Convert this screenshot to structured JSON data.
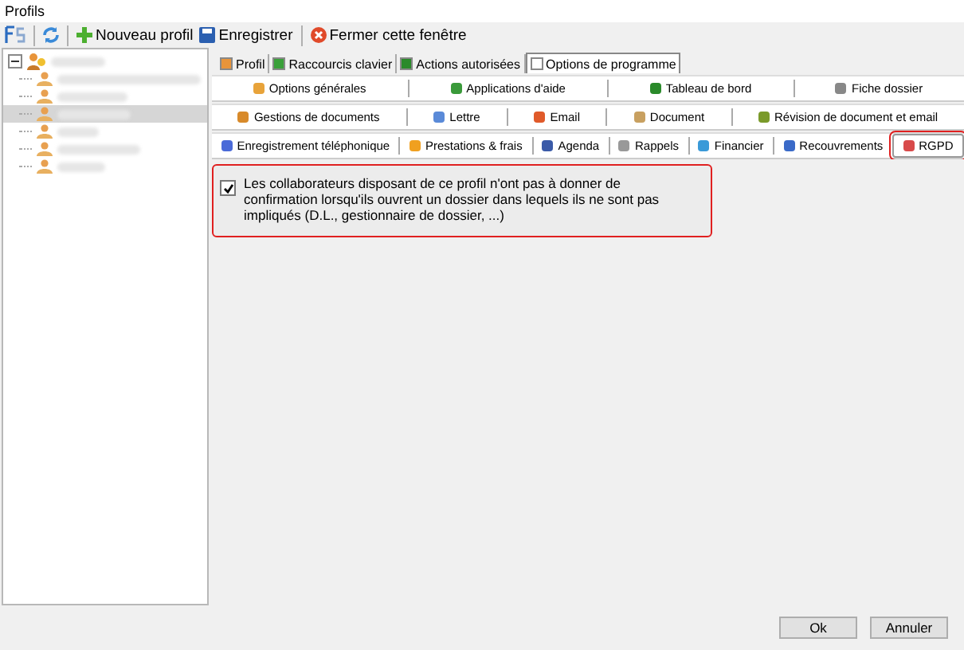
{
  "window": {
    "title": "Profils"
  },
  "toolbar": [
    {
      "kind": "fs"
    },
    {
      "kind": "refresh"
    },
    {
      "kind": "add",
      "label": "Nouveau profil"
    },
    {
      "kind": "save",
      "label": "Enregistrer"
    },
    {
      "kind": "close",
      "label": "Fermer cette fenêtre"
    }
  ],
  "tree": {
    "expanded": true,
    "children": [
      {
        "selected": false
      },
      {
        "selected": false
      },
      {
        "selected": true
      },
      {
        "selected": false
      },
      {
        "selected": false
      },
      {
        "selected": false
      }
    ]
  },
  "main_tabs": [
    {
      "label": "Profil",
      "selected": false
    },
    {
      "label": "Raccourcis clavier",
      "selected": false
    },
    {
      "label": "Actions autorisées",
      "selected": false
    },
    {
      "label": "Options de programme",
      "selected": true
    }
  ],
  "option_tab_rows": [
    [
      {
        "label": "Options générales",
        "selected": false,
        "highlighted": false
      },
      {
        "label": "Applications d'aide",
        "selected": false,
        "highlighted": false
      },
      {
        "label": "Tableau de bord",
        "selected": false,
        "highlighted": false
      },
      {
        "label": "Fiche dossier",
        "selected": false,
        "highlighted": false
      }
    ],
    [
      {
        "label": "Gestions de documents",
        "selected": false,
        "highlighted": false
      },
      {
        "label": "Lettre",
        "selected": false,
        "highlighted": false
      },
      {
        "label": "Email",
        "selected": false,
        "highlighted": false
      },
      {
        "label": "Document",
        "selected": false,
        "highlighted": false
      },
      {
        "label": "Révision de document et email",
        "selected": false,
        "highlighted": false
      }
    ],
    [
      {
        "label": "Enregistrement téléphonique",
        "selected": false,
        "highlighted": false
      },
      {
        "label": "Prestations & frais",
        "selected": false,
        "highlighted": false
      },
      {
        "label": "Agenda",
        "selected": false,
        "highlighted": false
      },
      {
        "label": "Rappels",
        "selected": false,
        "highlighted": false
      },
      {
        "label": "Financier",
        "selected": false,
        "highlighted": false
      },
      {
        "label": "Recouvrements",
        "selected": false,
        "highlighted": false
      },
      {
        "label": "RGPD",
        "selected": true,
        "highlighted": true
      }
    ]
  ],
  "option": {
    "checked": true,
    "highlighted": true,
    "label": "Les collaborateurs disposant de ce profil n'ont pas à donner de confirmation lorsqu'ils ouvrent un dossier dans lequels ils ne sont pas impliqués (D.L., gestionnaire de dossier, ...)"
  },
  "buttons": [
    "Ok",
    "Annuler"
  ]
}
